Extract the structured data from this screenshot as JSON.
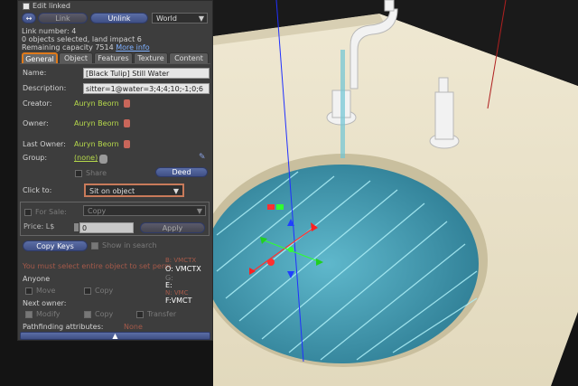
{
  "panel": {
    "edit_linked": "Edit linked",
    "link_label": "Link",
    "unlink_label": "Unlink",
    "world_label": "World",
    "link_number": "Link number: 4",
    "objects_selected": "0 objects selected, land impact 6",
    "remaining_capacity": "Remaining capacity 7514",
    "more_info": "More info",
    "tabs": [
      "General",
      "Object",
      "Features",
      "Texture",
      "Content"
    ],
    "name_label": "Name:",
    "name_value": "[Black Tulip] Still Water",
    "description_label": "Description:",
    "description_value": "sitter=1@water=3;4;4;10;-1;0;6",
    "creator_label": "Creator:",
    "creator_value": "Auryn Beorn",
    "owner_label": "Owner:",
    "owner_value": "Auryn Beorn",
    "last_owner_label": "Last Owner:",
    "last_owner_value": "Auryn Beorn",
    "group_label": "Group:",
    "group_value": "(none)",
    "share_label": "Share",
    "deed_label": "Deed",
    "click_to_label": "Click to:",
    "click_to_value": "Sit on object",
    "for_sale_label": "For Sale:",
    "copy_option": "Copy",
    "price_label": "Price: L$",
    "price_value": "0",
    "apply_label": "Apply",
    "copy_keys_label": "Copy Keys",
    "show_in_search_label": "Show in search",
    "warning_text": "You must select entire object to set permissions.",
    "anyone_label": "Anyone",
    "move_label": "Move",
    "copy_label": "Copy",
    "next_owner_label": "Next owner:",
    "modify_label": "Modify",
    "transfer_label": "Transfer",
    "pathfinding_label": "Pathfinding attributes:",
    "pathfinding_value": "None",
    "perm_b": "B: VMCTX",
    "perm_o": "O: VMCTX",
    "perm_g": "G:",
    "perm_e": "E:",
    "perm_n": "N: VMC",
    "perm_f": "F:VMCT"
  },
  "colors": {
    "accent_orange": "#e07a1a",
    "name_green": "#b6d94b",
    "button_blue": "#4a5c98",
    "water": "#4aa8c0"
  }
}
